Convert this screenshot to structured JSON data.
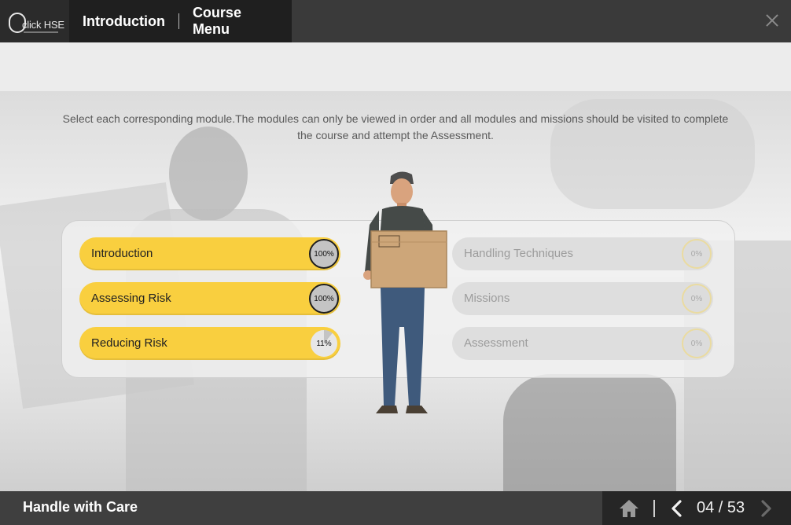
{
  "app": {
    "logo_text": "click HSE",
    "nav": {
      "introduction": "Introduction",
      "course_menu": "Course Menu"
    }
  },
  "instructions": "Select each corresponding module.The modules can only be viewed in order and all modules and missions should be visited to complete the course and attempt the Assessment.",
  "modules": [
    {
      "label": "Introduction",
      "progress": "100%",
      "status": "complete"
    },
    {
      "label": "Assessing Risk",
      "progress": "100%",
      "status": "complete"
    },
    {
      "label": "Reducing Risk",
      "progress": "11%",
      "status": "in-progress"
    },
    {
      "label": "Handling Techniques",
      "progress": "0%",
      "status": "locked"
    },
    {
      "label": "Missions",
      "progress": "0%",
      "status": "locked"
    },
    {
      "label": "Assessment",
      "progress": "0%",
      "status": "locked"
    }
  ],
  "footer": {
    "course_title": "Handle with Care",
    "page_counter": "04 / 53"
  },
  "colors": {
    "accent": "#f9cf3f",
    "topbar": "#3a3a3a",
    "bottombar": "#3f3f3f"
  }
}
